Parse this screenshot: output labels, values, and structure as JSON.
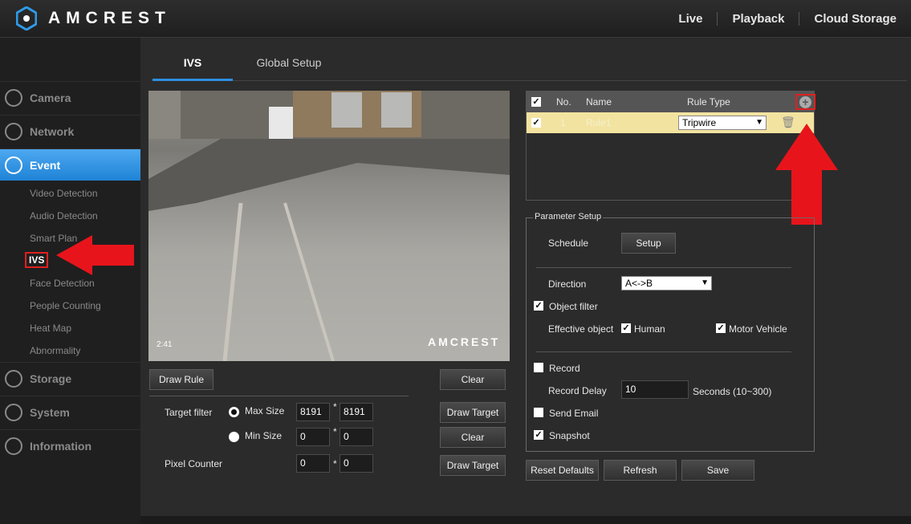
{
  "brand": "AMCREST",
  "topnav": [
    "Live",
    "Playback",
    "Cloud Storage"
  ],
  "sidebar": {
    "items": [
      {
        "label": "Camera",
        "icon": "camera-icon"
      },
      {
        "label": "Network",
        "icon": "globe-icon"
      },
      {
        "label": "Event",
        "icon": "alarm-icon"
      },
      {
        "label": "Storage",
        "icon": "cloud-icon"
      },
      {
        "label": "System",
        "icon": "monitor-icon"
      },
      {
        "label": "Information",
        "icon": "info-icon"
      }
    ],
    "event_sub": [
      "Video Detection",
      "Audio Detection",
      "Smart Plan",
      "IVS",
      "Face Detection",
      "People Counting",
      "Heat Map",
      "Abnormality"
    ]
  },
  "tabs": [
    "IVS",
    "Global Setup"
  ],
  "video": {
    "timestamp": "2:41",
    "watermark": "AMCREST"
  },
  "left_controls": {
    "draw_rule": "Draw Rule",
    "clear1": "Clear",
    "target_filter": "Target filter",
    "max_size": "Max Size",
    "min_size": "Min Size",
    "max_w": "8191",
    "max_h": "8191",
    "min_w": "0",
    "min_h": "0",
    "draw_target1": "Draw Target",
    "clear2": "Clear",
    "pixel_counter": "Pixel Counter",
    "pc_w": "0",
    "pc_h": "0",
    "draw_target2": "Draw Target",
    "times": "*"
  },
  "rule_table": {
    "headers": {
      "no": "No.",
      "name": "Name",
      "type": "Rule Type"
    },
    "row": {
      "no": "1",
      "name": "Rule1",
      "type": "Tripwire"
    }
  },
  "params": {
    "legend": "Parameter Setup",
    "schedule": "Schedule",
    "setup": "Setup",
    "direction": "Direction",
    "direction_value": "A<->B",
    "object_filter": "Object filter",
    "effective_object": "Effective object",
    "human": "Human",
    "motor_vehicle": "Motor Vehicle",
    "record": "Record",
    "record_delay": "Record Delay",
    "record_delay_value": "10",
    "seconds_hint": "Seconds (10~300)",
    "send_email": "Send Email",
    "snapshot": "Snapshot"
  },
  "actions": {
    "reset": "Reset Defaults",
    "refresh": "Refresh",
    "save": "Save"
  },
  "colors": {
    "accent": "#1f83d6",
    "highlight": "#e02020",
    "row": "#f3e3a0"
  }
}
